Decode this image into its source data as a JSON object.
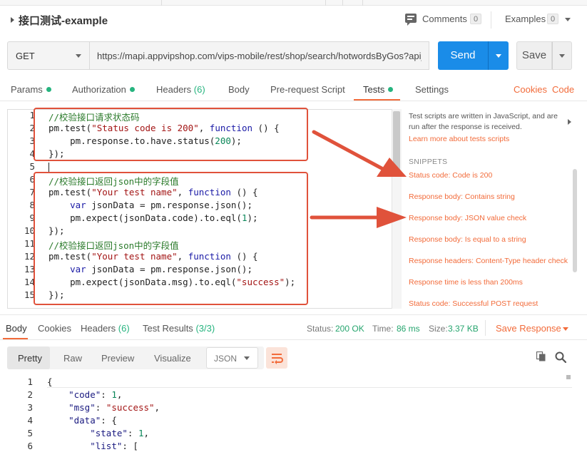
{
  "request": {
    "title": "接口测试-example",
    "comments_label": "Comments",
    "comments_count": "0",
    "examples_label": "Examples",
    "examples_count": "0",
    "method": "GET",
    "url": "https://mapi.appvipshop.com/vips-mobile/rest/shop/search/hotwordsByGos?api_key=",
    "send_label": "Send",
    "save_label": "Save"
  },
  "tabs": [
    {
      "label": "Params",
      "dot": true
    },
    {
      "label": "Authorization",
      "dot": true
    },
    {
      "label": "Headers",
      "count": "(6)"
    },
    {
      "label": "Body"
    },
    {
      "label": "Pre-request Script"
    },
    {
      "label": "Tests",
      "dot": true,
      "active": true
    },
    {
      "label": "Settings"
    }
  ],
  "tab_links": {
    "cookies": "Cookies",
    "code": "Code"
  },
  "editor": {
    "line_numbers": [
      "1",
      "2",
      "3",
      "4",
      "5",
      "6",
      "7",
      "8",
      "9",
      "10",
      "11",
      "12",
      "13",
      "14",
      "15"
    ],
    "lines": [
      {
        "seg": [
          {
            "t": "//校验接口请求状态码",
            "c": "c-cmt"
          }
        ]
      },
      {
        "seg": [
          {
            "t": "pm.test(",
            "c": ""
          },
          {
            "t": "\"Status code is 200\"",
            "c": "c-str"
          },
          {
            "t": ", ",
            "c": ""
          },
          {
            "t": "function",
            "c": "c-kw"
          },
          {
            "t": " () {",
            "c": ""
          }
        ]
      },
      {
        "seg": [
          {
            "t": "    pm.response.to.have.status(",
            "c": ""
          },
          {
            "t": "200",
            "c": "c-num"
          },
          {
            "t": ");",
            "c": ""
          }
        ]
      },
      {
        "seg": [
          {
            "t": "});",
            "c": ""
          }
        ]
      },
      {
        "seg": []
      },
      {
        "seg": [
          {
            "t": "//校验接口返回json中的字段值",
            "c": "c-cmt"
          }
        ]
      },
      {
        "seg": [
          {
            "t": "pm.test(",
            "c": ""
          },
          {
            "t": "\"Your test name\"",
            "c": "c-str"
          },
          {
            "t": ", ",
            "c": ""
          },
          {
            "t": "function",
            "c": "c-kw"
          },
          {
            "t": " () {",
            "c": ""
          }
        ]
      },
      {
        "seg": [
          {
            "t": "    ",
            "c": ""
          },
          {
            "t": "var",
            "c": "c-kw"
          },
          {
            "t": " jsonData = pm.response.json();",
            "c": ""
          }
        ]
      },
      {
        "seg": [
          {
            "t": "    pm.expect(jsonData.code).to.eql(",
            "c": ""
          },
          {
            "t": "1",
            "c": "c-num"
          },
          {
            "t": ");",
            "c": ""
          }
        ]
      },
      {
        "seg": [
          {
            "t": "});",
            "c": ""
          }
        ]
      },
      {
        "seg": [
          {
            "t": "//校验接口返回json中的字段值",
            "c": "c-cmt"
          }
        ]
      },
      {
        "seg": [
          {
            "t": "pm.test(",
            "c": ""
          },
          {
            "t": "\"Your test name\"",
            "c": "c-str"
          },
          {
            "t": ", ",
            "c": ""
          },
          {
            "t": "function",
            "c": "c-kw"
          },
          {
            "t": " () {",
            "c": ""
          }
        ]
      },
      {
        "seg": [
          {
            "t": "    ",
            "c": ""
          },
          {
            "t": "var",
            "c": "c-kw"
          },
          {
            "t": " jsonData = pm.response.json();",
            "c": ""
          }
        ]
      },
      {
        "seg": [
          {
            "t": "    pm.expect(jsonData.msg).to.eql(",
            "c": ""
          },
          {
            "t": "\"success\"",
            "c": "c-str"
          },
          {
            "t": ");",
            "c": ""
          }
        ]
      },
      {
        "seg": [
          {
            "t": "});",
            "c": ""
          }
        ]
      }
    ]
  },
  "side": {
    "description": "Test scripts are written in JavaScript, and are run after the response is received.",
    "learn_link": "Learn more about tests scripts",
    "snippets_heading": "SNIPPETS",
    "snippets": [
      "Status code: Code is 200",
      "Response body: Contains string",
      "Response body: JSON value check",
      "Response body: Is equal to a string",
      "Response headers: Content-Type header check",
      "Response time is less than 200ms",
      "Status code: Successful POST request"
    ]
  },
  "response": {
    "tabs": [
      {
        "label": "Body",
        "active": true
      },
      {
        "label": "Cookies"
      },
      {
        "label": "Headers",
        "count": "(6)"
      },
      {
        "label": "Test Results",
        "count": "(3/3)"
      }
    ],
    "status_label": "Status:",
    "status_value": "200 OK",
    "time_label": "Time:",
    "time_value": "86 ms",
    "size_label": "Size:",
    "size_value": "3.37 KB",
    "save_response": "Save Response",
    "views": [
      "Pretty",
      "Raw",
      "Preview",
      "Visualize"
    ],
    "format": "JSON",
    "line_numbers": [
      "1",
      "2",
      "3",
      "4",
      "5",
      "6"
    ],
    "lines": [
      {
        "seg": [
          {
            "t": "{",
            "c": ""
          }
        ]
      },
      {
        "seg": [
          {
            "t": "    ",
            "c": ""
          },
          {
            "t": "\"code\"",
            "c": "j-key"
          },
          {
            "t": ": ",
            "c": ""
          },
          {
            "t": "1",
            "c": "j-num"
          },
          {
            "t": ",",
            "c": ""
          }
        ]
      },
      {
        "seg": [
          {
            "t": "    ",
            "c": ""
          },
          {
            "t": "\"msg\"",
            "c": "j-key"
          },
          {
            "t": ": ",
            "c": ""
          },
          {
            "t": "\"success\"",
            "c": "j-str"
          },
          {
            "t": ",",
            "c": ""
          }
        ]
      },
      {
        "seg": [
          {
            "t": "    ",
            "c": ""
          },
          {
            "t": "\"data\"",
            "c": "j-key"
          },
          {
            "t": ": {",
            "c": ""
          }
        ]
      },
      {
        "seg": [
          {
            "t": "        ",
            "c": ""
          },
          {
            "t": "\"state\"",
            "c": "j-key"
          },
          {
            "t": ": ",
            "c": ""
          },
          {
            "t": "1",
            "c": "j-num"
          },
          {
            "t": ",",
            "c": ""
          }
        ]
      },
      {
        "seg": [
          {
            "t": "        ",
            "c": ""
          },
          {
            "t": "\"list\"",
            "c": "j-key"
          },
          {
            "t": ": [",
            "c": ""
          }
        ]
      }
    ]
  },
  "colors": {
    "accent": "#f26b3a",
    "send": "#1a8ce8",
    "success": "#26b47f",
    "annotation": "#e0523b"
  },
  "icons": [
    "caret-right-icon",
    "comments-icon",
    "chevron-down-icon",
    "chevron-right-icon",
    "wrap-lines-icon",
    "copy-icon",
    "search-icon"
  ]
}
